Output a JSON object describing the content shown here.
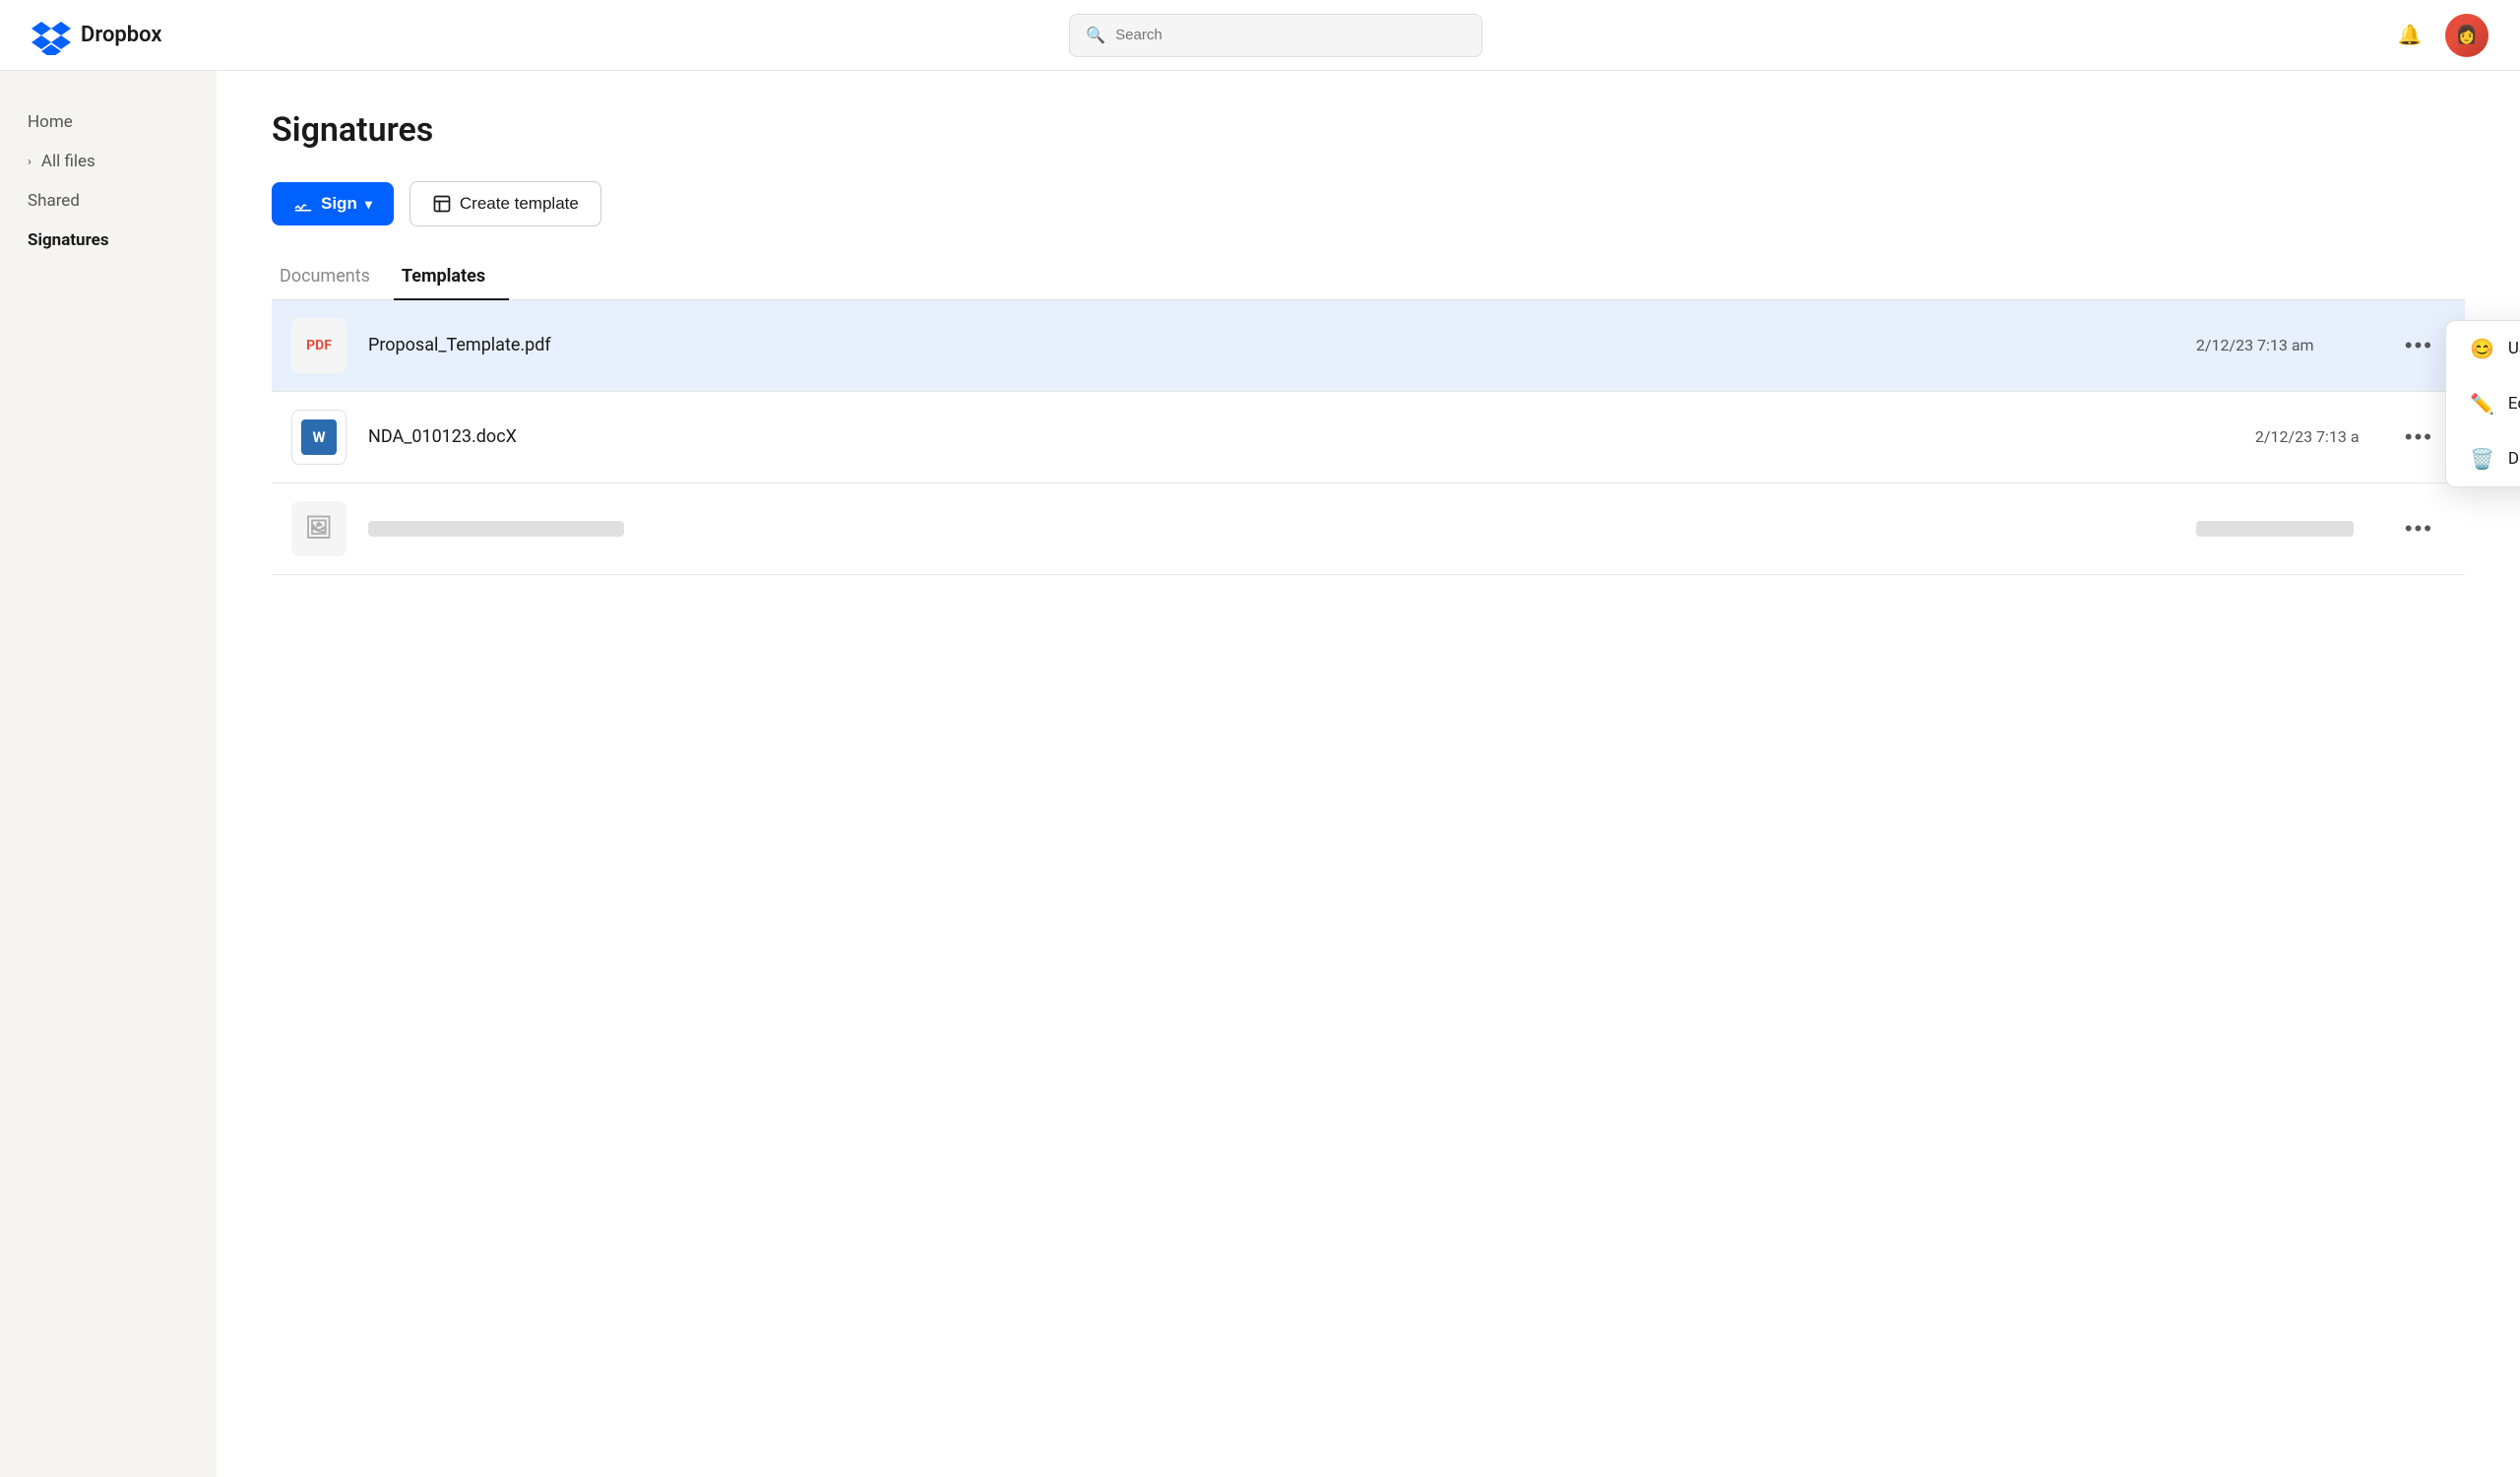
{
  "header": {
    "logo_text": "Dropbox",
    "search_placeholder": "Search"
  },
  "sidebar": {
    "items": [
      {
        "id": "home",
        "label": "Home",
        "active": false,
        "has_chevron": false
      },
      {
        "id": "all-files",
        "label": "All files",
        "active": false,
        "has_chevron": true
      },
      {
        "id": "shared",
        "label": "Shared",
        "active": false,
        "has_chevron": false
      },
      {
        "id": "signatures",
        "label": "Signatures",
        "active": true,
        "has_chevron": false
      }
    ]
  },
  "main": {
    "page_title": "Signatures",
    "toolbar": {
      "sign_label": "Sign",
      "create_template_label": "Create template"
    },
    "tabs": [
      {
        "id": "documents",
        "label": "Documents",
        "active": false
      },
      {
        "id": "templates",
        "label": "Templates",
        "active": true
      }
    ],
    "files": [
      {
        "id": "proposal",
        "name": "Proposal_Template.pdf",
        "date": "2/12/23 7:13 am",
        "type": "pdf",
        "highlighted": true,
        "show_menu": true
      },
      {
        "id": "nda",
        "name": "NDA_010123.docX",
        "date": "2/12/23 7:13 a",
        "type": "docx",
        "highlighted": false,
        "show_menu": false
      },
      {
        "id": "img",
        "name": "",
        "date": "",
        "type": "image",
        "highlighted": false,
        "show_menu": false
      }
    ],
    "context_menu": {
      "items": [
        {
          "id": "use",
          "label": "Use",
          "icon": "😊"
        },
        {
          "id": "edit",
          "label": "Edit",
          "icon": "✏️"
        },
        {
          "id": "delete",
          "label": "Delete",
          "icon": "🗑️"
        }
      ]
    }
  }
}
